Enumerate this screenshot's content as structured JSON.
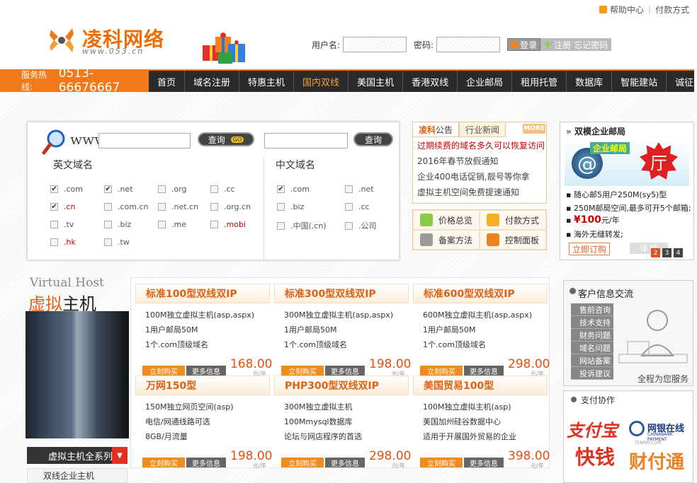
{
  "top_links": {
    "help": "帮助中心",
    "pay": "付款方式"
  },
  "logo": {
    "title": "凌科网络",
    "subtitle": "www.053.cn"
  },
  "login": {
    "username_label": "用户名:",
    "password_label": "密码:",
    "login_btn": "登录",
    "register_btn": "注册",
    "forgot": "忘记密码"
  },
  "hotline": {
    "label": "服务热线:",
    "number": "0513-66676667"
  },
  "nav": [
    "首页",
    "域名注册",
    "特惠主机",
    "国内双线",
    "美国主机",
    "香港双线",
    "企业邮局",
    "租用托管",
    "数据库",
    "智能建站",
    "诚征代理"
  ],
  "nav_active": "国内双线",
  "domain": {
    "www": "www.",
    "query": "查询",
    "go": "GO",
    "en_heading": "英文域名",
    "cn_heading": "中文域名",
    "en_items": [
      {
        "label": ".com",
        "checked": true,
        "red": false
      },
      {
        "label": ".net",
        "checked": true,
        "red": false
      },
      {
        "label": ".org",
        "checked": false,
        "red": false
      },
      {
        "label": ".cc",
        "checked": false,
        "red": false
      },
      {
        "label": ".cn",
        "checked": true,
        "red": true
      },
      {
        "label": ".com.cn",
        "checked": false,
        "red": false
      },
      {
        "label": ".net.cn",
        "checked": false,
        "red": false
      },
      {
        "label": ".org.cn",
        "checked": false,
        "red": false
      },
      {
        "label": ".tv",
        "checked": false,
        "red": false
      },
      {
        "label": ".biz",
        "checked": false,
        "red": false
      },
      {
        "label": ".me",
        "checked": false,
        "red": false
      },
      {
        "label": ".mobi",
        "checked": false,
        "red": true
      },
      {
        "label": ".hk",
        "checked": false,
        "red": true
      },
      {
        "label": ".tw",
        "checked": false,
        "red": false
      }
    ],
    "cn_items": [
      {
        "label": ".com",
        "checked": true
      },
      {
        "label": ".net",
        "checked": false
      },
      {
        "label": ".biz",
        "checked": false
      },
      {
        "label": ".cc",
        "checked": false
      },
      {
        "label": ".中国(.cn)",
        "checked": false
      },
      {
        "label": ".公司",
        "checked": false
      }
    ]
  },
  "news": {
    "tab1_brand": "凌科",
    "tab1": "公告",
    "tab2": "行业新闻",
    "more": "MORE",
    "items": [
      "过期续费的域名多久可以恢复访问",
      "2016年春节放假通知",
      "企业400电话促销,靓号等你拿",
      "虚拟主机空间免费提速通知"
    ]
  },
  "quick": [
    "价格总览",
    "付款方式",
    "备案方法",
    "控制面板"
  ],
  "mail_ad": {
    "title": "双模企业邮局",
    "banner_text": "企业邮局",
    "badge": "厅",
    "lines": [
      "随心邮5用户250M(sy5)型",
      "250M邮局空间,最多可开5个邮箱;",
      "海外无缝转发;"
    ],
    "price_prefix": "¥",
    "price": "100",
    "price_unit": "元/年",
    "order": "立即订购",
    "detail": "详 情",
    "pages": [
      "2",
      "3",
      "4"
    ]
  },
  "virtual_host": {
    "en": "Virtual Host",
    "cn_o": "虚拟",
    "cn": "主机",
    "menu": "虚拟主机全系列",
    "item": "双线企业主机"
  },
  "products": [
    {
      "title": "标准100型双线双IP",
      "lines": [
        "100M独立虚拟主机(asp,aspx)",
        "1用户邮局50M",
        "1个.com顶级域名"
      ],
      "price": "168.00"
    },
    {
      "title": "标准300型双线双IP",
      "lines": [
        "300M独立虚拟主机(asp,aspx)",
        "1用户邮局50M",
        "1个.com顶级域名"
      ],
      "price": "198.00"
    },
    {
      "title": "标准600型双线双IP",
      "lines": [
        "600M独立虚拟主机(asp,aspx)",
        "1用户邮局50M",
        "1个.com顶级域名"
      ],
      "price": "298.00"
    },
    {
      "title": "万网150型",
      "lines": [
        "150M独立网页空间(asp)",
        "电信/网通线路可选",
        "8GB/月流量"
      ],
      "price": "198.00"
    },
    {
      "title": "PHP300型双线双IP",
      "lines": [
        "300M独立虚拟主机",
        "100Mmysql数据库",
        "论坛与网店程序的首选"
      ],
      "price": "298.00"
    },
    {
      "title": "美国贸易100型",
      "lines": [
        "100M独立虚拟主机(asp)",
        "美国加州硅谷数据中心",
        "适用于开展国外贸易的企业"
      ],
      "price": "398.00"
    }
  ],
  "product_buttons": {
    "buy": "立刻购买",
    "more": "更多信息",
    "unit": "元/年"
  },
  "customer": {
    "title": "客户信息交流",
    "links": [
      "售前咨询",
      "技术支持",
      "财务问题",
      "域名问题",
      "网站备案",
      "投诉建议"
    ],
    "slogan": "全程为您服务"
  },
  "payment": {
    "title": "支付协作",
    "alipay": "支付宝",
    "chinabank": "网银在线",
    "chinabank_en": "CHINABANK PAYMENT",
    "kuaiqian": "快钱",
    "tenpay": "财付通",
    "tenpay_en": "TENPAY.COM"
  },
  "colors": {
    "accent": "#f07a1a",
    "nav_bg": "#2a2a2a",
    "red": "#cc0000"
  }
}
